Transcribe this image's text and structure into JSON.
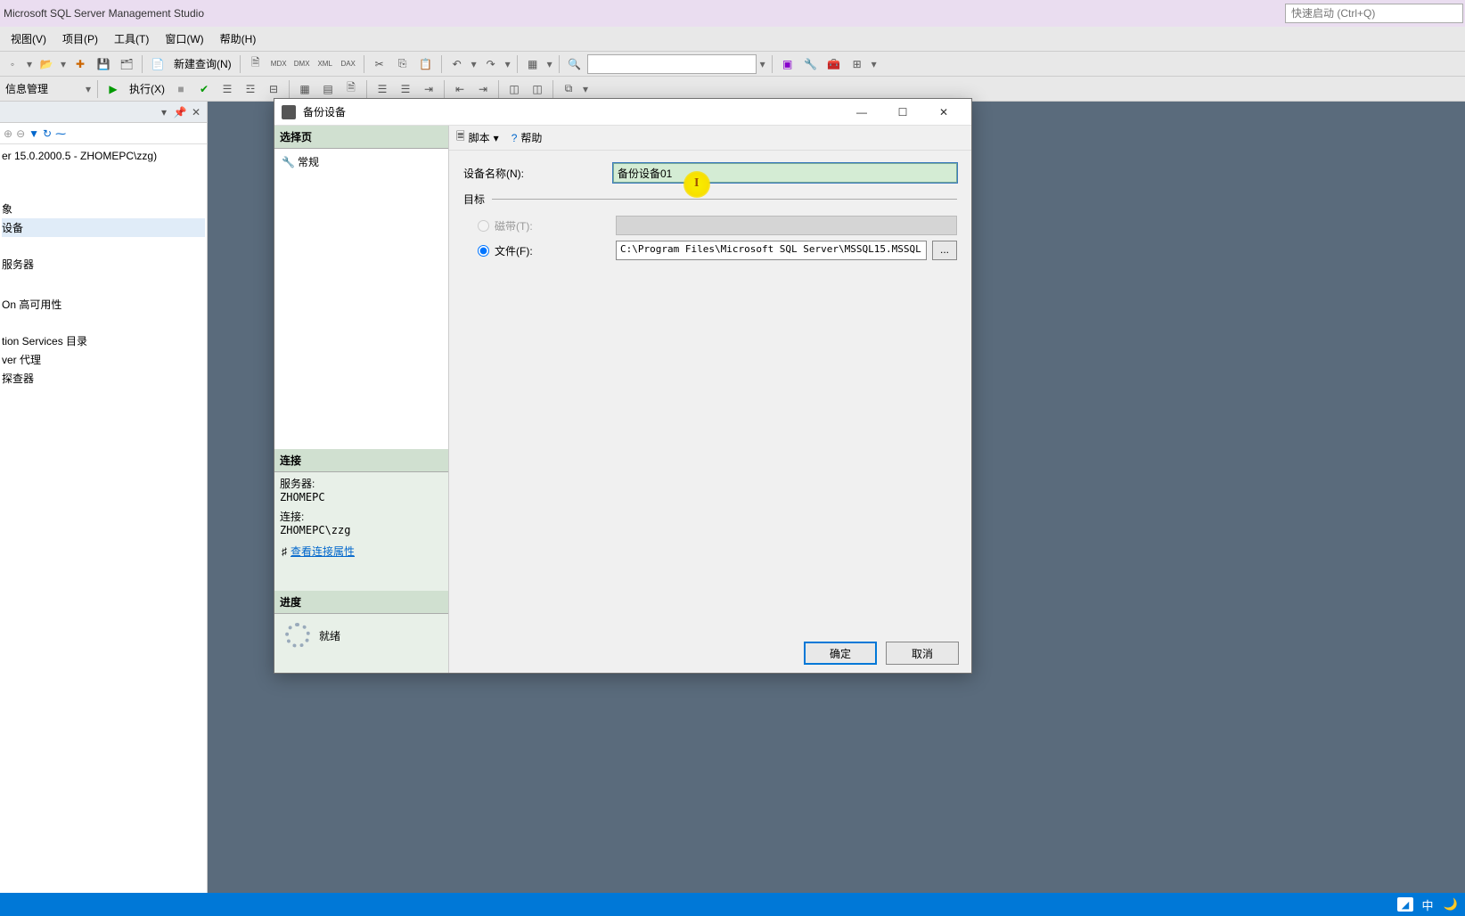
{
  "app": {
    "title": "Microsoft SQL Server Management Studio",
    "quicklaunch_placeholder": "快速启动 (Ctrl+Q)"
  },
  "menu": {
    "view": "视图(V)",
    "project": "项目(P)",
    "tools": "工具(T)",
    "window": "窗口(W)",
    "help": "帮助(H)"
  },
  "toolbar1": {
    "new_query": "新建查询(N)"
  },
  "toolbar2": {
    "combo": "信息管理",
    "execute": "执行(X)"
  },
  "explorer": {
    "server": "er 15.0.2000.5 - ZHOMEPC\\zzg)",
    "items": [
      "象",
      "设备",
      "服务器",
      "",
      "On 高可用性",
      "tion Services 目录",
      "ver 代理",
      "探查器"
    ]
  },
  "dialog": {
    "title": "备份设备",
    "left": {
      "select_page": "选择页",
      "general": "常规",
      "connection": "连接",
      "server_label": "服务器:",
      "server_value": "ZHOMEPC",
      "conn_label": "连接:",
      "conn_value": "ZHOMEPC\\zzg",
      "view_conn": "查看连接属性",
      "progress": "进度",
      "ready": "就绪"
    },
    "toolbar": {
      "script": "脚本",
      "help": "帮助"
    },
    "form": {
      "device_name_label": "设备名称(N):",
      "device_name_value": "备份设备01",
      "target_legend": "目标",
      "tape_label": "磁带(T):",
      "file_label": "文件(F):",
      "file_value": "C:\\Program Files\\Microsoft SQL Server\\MSSQL15.MSSQL",
      "browse": "..."
    },
    "buttons": {
      "ok": "确定",
      "cancel": "取消"
    }
  },
  "ime": {
    "lang": "中"
  }
}
